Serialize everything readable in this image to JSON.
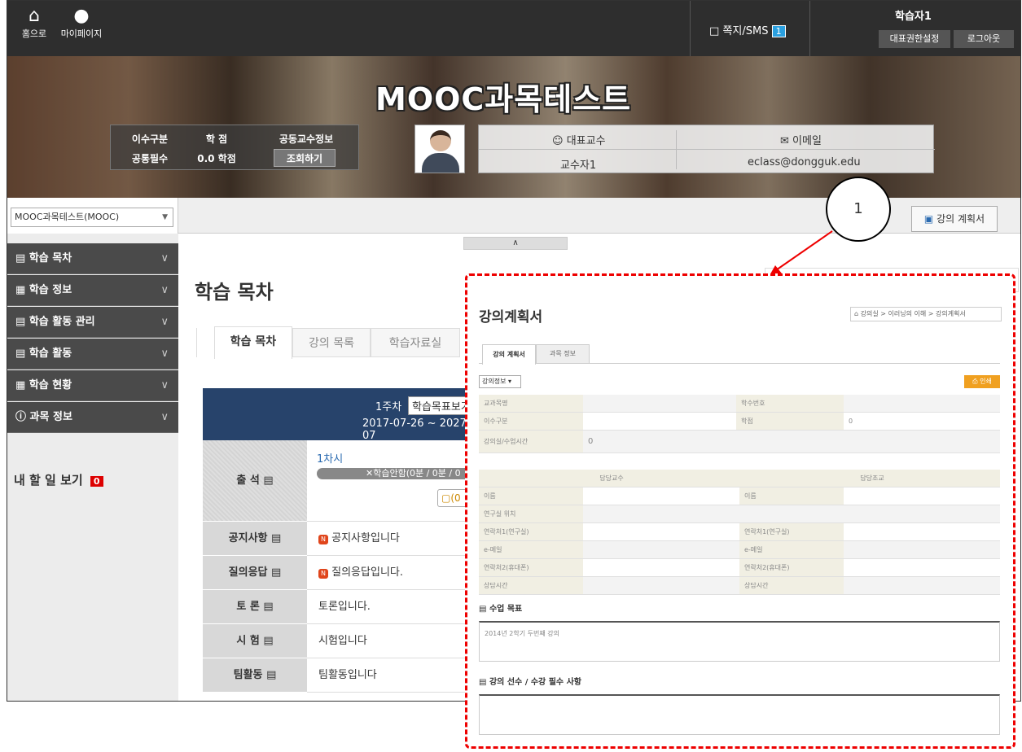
{
  "top": {
    "home_label": "홈으로",
    "mypage_label": "마이페이지",
    "message_label": "쪽지/SMS",
    "message_count": "1",
    "user_name": "학습자1",
    "rep_button": "대표권한설정",
    "logout_button": "로그아웃"
  },
  "banner": {
    "title": "MOOC과목테스트",
    "info_headers": [
      "이수구분",
      "학 점",
      "공동교수정보"
    ],
    "info_values": [
      "공통필수",
      "0.0 학점",
      "조회하기"
    ],
    "prof_header": "대표교수",
    "email_header": "이메일",
    "prof_name": "교수자1",
    "email": "eclass@dongguk.edu"
  },
  "nav": {
    "course_select": "MOOC과목테스트(MOOC)",
    "syllabus_button": "강의 계획서",
    "callout_number": "1"
  },
  "sidebar": {
    "items": [
      "학습 목차",
      "학습 정보",
      "학습 활동 관리",
      "학습 활동",
      "학습 현황",
      "과목 정보"
    ],
    "todo_label": "내 할 일 보기",
    "todo_count": "0"
  },
  "main": {
    "page_title": "학습 목차",
    "tabs": [
      "학습 목차",
      "강의 목록",
      "학습자료실"
    ],
    "week_label": "1주차",
    "week_goal_button": "학습목표보기",
    "week_dates": "2017-07-26 ~ 2027-07",
    "rows": [
      {
        "label": "출 석",
        "value": "1차시"
      },
      {
        "label": "공지사항",
        "value": "공지사항입니다"
      },
      {
        "label": "질의응답",
        "value": "질의응답입니다."
      },
      {
        "label": "토 론",
        "value": "토론입니다."
      },
      {
        "label": "시 험",
        "value": "시험입니다"
      },
      {
        "label": "팀활동",
        "value": "팀활동입니다"
      }
    ],
    "progress_text": "학습안함(0분 / 0분 / 0",
    "comment_count": "(0"
  },
  "syllabus": {
    "title": "강의계획서",
    "breadcrumb": [
      "강의실",
      "이러닝의 이해",
      "강의계획서"
    ],
    "tabs": [
      "강의 계획서",
      "과목 정보"
    ],
    "select": "강의정보",
    "print_button": "인쇄",
    "rows1": [
      [
        "교과목명",
        "",
        "학수번호",
        ""
      ],
      [
        "이수구분",
        "",
        "학점",
        "0"
      ]
    ],
    "room_label": "강의실/수업시간",
    "room_value": "0",
    "section_headers": [
      "담당교수",
      "담당조교"
    ],
    "rows2_left": [
      "이름",
      "연구실 위치",
      "연락처1(연구실)",
      "e-메일",
      "연락처2(휴대폰)",
      "상담시간"
    ],
    "rows2_right": [
      "이름",
      "",
      "연락처1(연구실)",
      "e-메일",
      "연락처2(휴대폰)",
      "상담시간"
    ],
    "goal_title": "수업 목표",
    "goal_text": "2014년 2학기 두번째 강의",
    "prereq_title": "강의 선수 / 수강 필수 사항"
  }
}
